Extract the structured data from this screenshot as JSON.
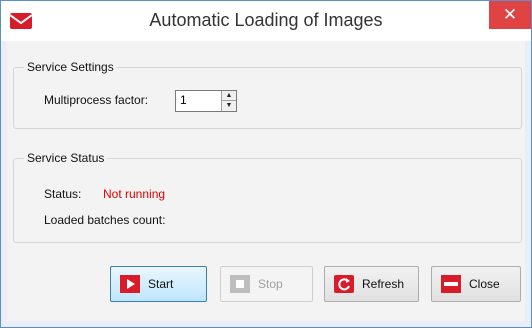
{
  "window": {
    "title": "Automatic Loading of Images",
    "close_glyph": "✕",
    "app_icon": "envelope-icon"
  },
  "service_settings": {
    "title": "Service Settings",
    "multiprocess_label": "Multiprocess factor:",
    "multiprocess_value": "1"
  },
  "service_status": {
    "title": "Service Status",
    "status_label": "Status:",
    "status_value": "Not running",
    "status_color": "#e00000",
    "loaded_label": "Loaded batches count:",
    "loaded_value": ""
  },
  "buttons": {
    "start": "Start",
    "stop": "Stop",
    "refresh": "Refresh",
    "close": "Close"
  }
}
